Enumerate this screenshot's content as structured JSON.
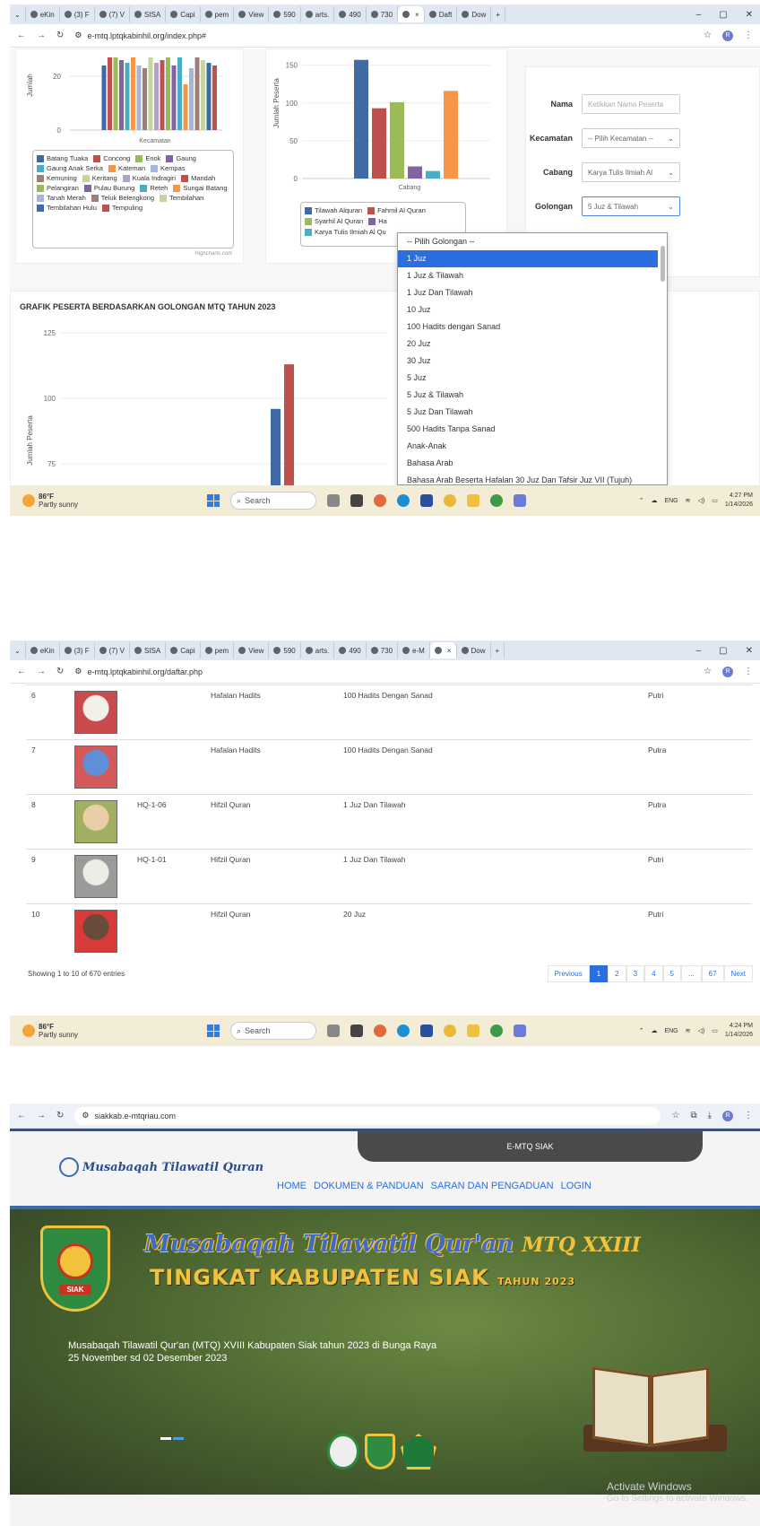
{
  "shot1": {
    "tabs": [
      "eKin",
      "(3) F",
      "(7) V",
      "SISA",
      "Capi",
      "pem",
      "View",
      "590",
      "arts.",
      "490",
      "730",
      "",
      "Daft",
      "Dow"
    ],
    "active_tab_index": 11,
    "url": "e-mtq.lptqkabinhil.org/index.php#",
    "chart_kecamatan": {
      "ylabel": "Jumlah",
      "xlabel": "Kecamatan",
      "ytick_20": "20",
      "ytick_0": "0",
      "credit": "Highcharts.com"
    },
    "legend_kecamatan": [
      {
        "label": "Batang Tuaka",
        "color": "#3f6aa6"
      },
      {
        "label": "Concong",
        "color": "#c0504d"
      },
      {
        "label": "Enok",
        "color": "#9bbb59"
      },
      {
        "label": "Gaung",
        "color": "#8064a2"
      },
      {
        "label": "Gaung Anak Serka",
        "color": "#4bacc6"
      },
      {
        "label": "Kateman",
        "color": "#f79646"
      },
      {
        "label": "Kempas",
        "color": "#a3b6dc"
      },
      {
        "label": "Kemuning",
        "color": "#a07d7a"
      },
      {
        "label": "Keritang",
        "color": "#c3d69b"
      },
      {
        "label": "Kuala Indragiri",
        "color": "#b3a2c7"
      },
      {
        "label": "Mandah",
        "color": "#c0504d"
      },
      {
        "label": "Pelangiran",
        "color": "#9bbb59"
      },
      {
        "label": "Pulau Burung",
        "color": "#8064a2"
      },
      {
        "label": "Reteh",
        "color": "#4bacc6"
      },
      {
        "label": "Sungai Batang",
        "color": "#f79646"
      },
      {
        "label": "Tanah Merah",
        "color": "#a3b6dc"
      },
      {
        "label": "Teluk Belengkong",
        "color": "#a07d7a"
      },
      {
        "label": "Tembilahan",
        "color": "#c3d69b"
      },
      {
        "label": "Tembilahan Hulu",
        "color": "#3f6aa6"
      },
      {
        "label": "Tempuling",
        "color": "#c0504d"
      }
    ],
    "chart_cabang": {
      "ylabel": "Jumlah Peserta",
      "xlabel": "Cabang",
      "ticks": [
        "150",
        "100",
        "50",
        "0"
      ]
    },
    "legend_cabang": [
      {
        "label": "Tilawah Alquran",
        "color": "#3f6aa6"
      },
      {
        "label": "Fahmil Al Quran",
        "color": "#c0504d"
      },
      {
        "label": "Syarhil Al Quran",
        "color": "#9bbb59"
      },
      {
        "label": "Ha",
        "color": "#8064a2"
      },
      {
        "label": "Karya Tulis Ilmiah Al Qu",
        "color": "#4bacc6"
      }
    ],
    "form": {
      "nama_label": "Nama",
      "nama_placeholder": "Ketikkan Nama Peserta",
      "kecamatan_label": "Kecamatan",
      "kecamatan_value": "-- Pilih Kecamatan --",
      "cabang_label": "Cabang",
      "cabang_value": "Karya Tulis Ilmiah Al",
      "golongan_label": "Golongan",
      "golongan_value": "5 Juz & Tilawah"
    },
    "dropdown_options": [
      "-- Pilih Golongan --",
      "1 Juz",
      "1 Juz & Tilawah",
      "1 Juz Dan Tilawah",
      "10 Juz",
      "100 Hadits dengan Sanad",
      "20 Juz",
      "30 Juz",
      "5 Juz",
      "5 Juz & Tilawah",
      "5 Juz Dan Tilawah",
      "500 Hadits Tanpa Sanad",
      "Anak-Anak",
      "Bahasa Arab",
      "Bahasa Arab Beserta Hafalan 30 Juz Dan Tafsir Juz VII (Tujuh)"
    ],
    "dropdown_selected_index": 1,
    "golongan_title": "GRAFIK PESERTA BERDASARKAN GOLONGAN MTQ TAHUN 2023",
    "golongan_ticks": [
      "125",
      "100",
      "75"
    ],
    "golongan_ylabel": "Jumlah Peserta",
    "taskbar": {
      "temp": "86°F",
      "weather": "Partly sunny",
      "search": "Search",
      "lang": "ENG",
      "time": "4:27 PM",
      "date": "1/14/2026"
    }
  },
  "chart_data": [
    {
      "type": "bar",
      "title": "",
      "xlabel": "Kecamatan",
      "ylabel": "Jumlah",
      "ylim": [
        0,
        30
      ],
      "categories": [
        "Batang Tuaka",
        "Concong",
        "Enok",
        "Gaung",
        "Gaung Anak Serka",
        "Kateman",
        "Kempas",
        "Kemuning",
        "Keritang",
        "Kuala Indragiri",
        "Mandah",
        "Pelangiran",
        "Pulau Burung",
        "Reteh",
        "Sungai Batang",
        "Tanah Merah",
        "Teluk Belengkong",
        "Tembilahan",
        "Tembilahan Hulu",
        "Tempuling"
      ],
      "values": [
        24,
        27,
        27,
        26,
        25,
        27,
        24,
        23,
        27,
        25,
        26,
        27,
        24,
        27,
        17,
        23,
        27,
        26,
        25,
        24
      ]
    },
    {
      "type": "bar",
      "title": "",
      "xlabel": "Cabang",
      "ylabel": "Jumlah Peserta",
      "ylim": [
        0,
        150
      ],
      "categories": [
        "Tilawah Alquran",
        "Fahmil Al Quran",
        "Syarhil Al Quran",
        "Ha",
        "Karya Tulis Ilmiah Al Qu",
        ""
      ],
      "values": [
        157,
        93,
        101,
        16,
        10,
        116
      ]
    },
    {
      "type": "bar",
      "title": "GRAFIK PESERTA BERDASARKAN GOLONGAN MTQ TAHUN 2023",
      "ylabel": "Jumlah Peserta",
      "ylim": [
        60,
        125
      ],
      "categories": [
        "",
        ""
      ],
      "values": [
        96,
        113
      ]
    }
  ],
  "shot2": {
    "url": "e-mtq.lptqkabinhil.org/daftar.php",
    "tabs": [
      "eKin",
      "(3) F",
      "(7) V",
      "SISA",
      "Capi",
      "pem",
      "View",
      "590",
      "arts.",
      "490",
      "730",
      "e-M",
      "",
      "Dow"
    ],
    "active_tab_index": 12,
    "rows": [
      {
        "no": "6",
        "code": "",
        "cabang": "Hafalan Hadits",
        "golongan": "100 Hadits Dengan Sanad",
        "gender": "Putri",
        "photo_bg": "#c94b4b",
        "photo_fg": "#f3f0ea"
      },
      {
        "no": "7",
        "code": "",
        "cabang": "Hafalan Hadits",
        "golongan": "100 Hadits Dengan Sanad",
        "gender": "Putra",
        "photo_bg": "#d45a5a",
        "photo_fg": "#5f8fd6"
      },
      {
        "no": "8",
        "code": "HQ-1-06",
        "cabang": "Hifzil Quran",
        "golongan": "1 Juz Dan Tilawah",
        "gender": "Putra",
        "photo_bg": "#a0b060",
        "photo_fg": "#e8cfa8"
      },
      {
        "no": "9",
        "code": "HQ-1-01",
        "cabang": "Hifzil Quran",
        "golongan": "1 Juz Dan Tilawah",
        "gender": "Putri",
        "photo_bg": "#9a9a98",
        "photo_fg": "#ecebe4"
      },
      {
        "no": "10",
        "code": "",
        "cabang": "Hifzil Quran",
        "golongan": "20 Juz",
        "gender": "Putri",
        "photo_bg": "#d93a3a",
        "photo_fg": "#6a4a3a"
      }
    ],
    "showing": "Showing 1 to 10 of 670 entries",
    "pager": [
      "Previous",
      "1",
      "2",
      "3",
      "4",
      "5",
      "...",
      "67",
      "Next"
    ],
    "taskbar": {
      "temp": "86°F",
      "weather": "Partly sunny",
      "search": "Search",
      "lang": "ENG",
      "time": "4:24 PM",
      "date": "1/14/2026"
    }
  },
  "shot3": {
    "url": "siakkab.e-mtqriau.com",
    "top_banner": "E-MTQ SIAK",
    "logo_text": "Musabaqah Tilawatil Quran",
    "nav": [
      "HOME",
      "DOKUMEN & PANDUAN",
      "SARAN DAN PENGADUAN",
      "LOGIN"
    ],
    "hero_title1": "Musabaqah Tilawatil Qur'an",
    "hero_title1b": "MTQ XXIII",
    "hero_title2": "TINGKAT KABUPATEN SIAK",
    "hero_year": "TAHUN 2023",
    "seal_text": "SIAK",
    "hero_desc": "Musabaqah Tilawatil Qur'an (MTQ) XVIII Kabupaten Siak tahun 2023 di Bunga Raya 25 November sd 02 Desember 2023",
    "activate1": "Activate Windows",
    "activate2": "Go to Settings to activate Windows."
  },
  "colors": {
    "accent": "#2a6ee0",
    "tab_bg": "#dfe7f3",
    "taskbar": "#f3ecd6",
    "hero_green": "#4f6a32",
    "gold": "#f2c23c"
  }
}
